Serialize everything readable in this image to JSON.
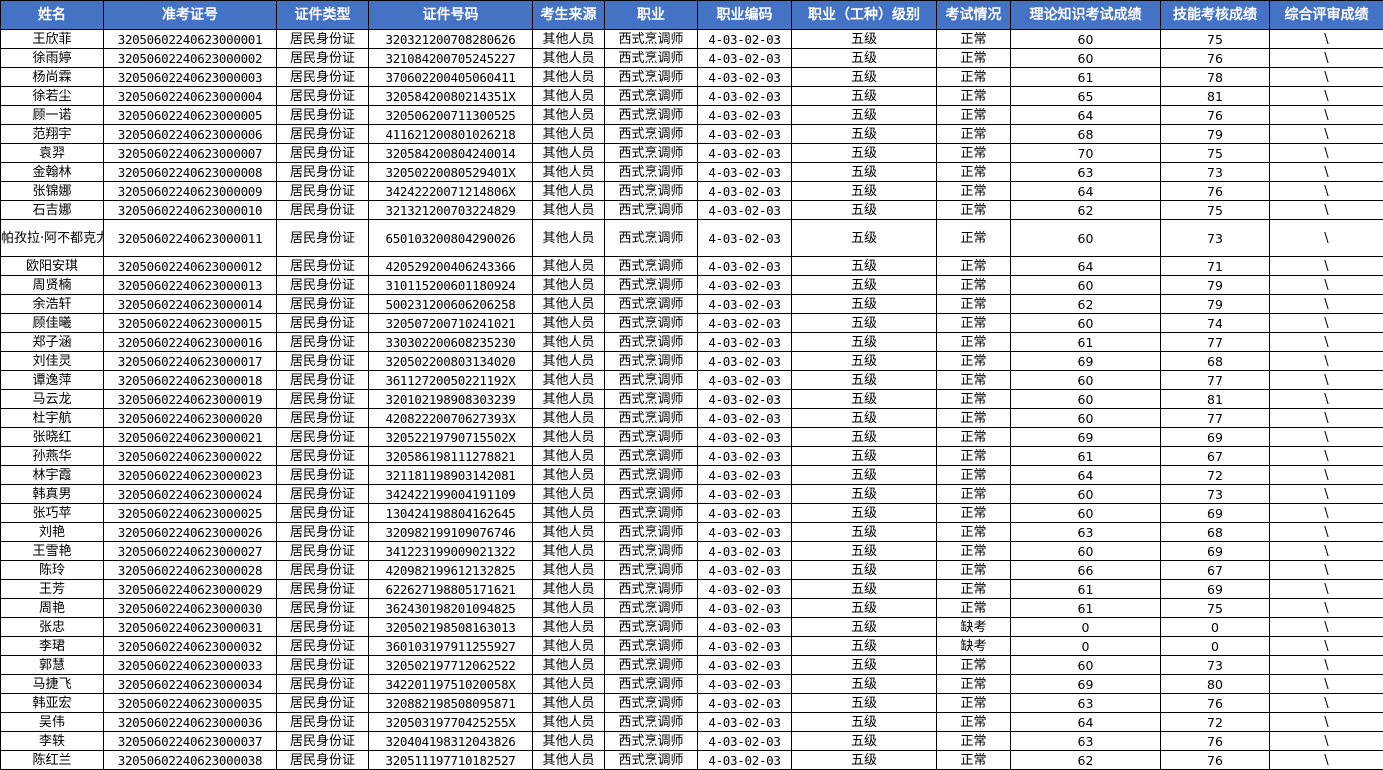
{
  "headers": [
    "姓名",
    "准考证号",
    "证件类型",
    "证件号码",
    "考生来源",
    "职业",
    "职业编码",
    "职业（工种）级别",
    "考试情况",
    "理论知识考试成绩",
    "技能考核成绩",
    "综合评审成绩"
  ],
  "rows": [
    [
      "王欣菲",
      "32050602240623000001",
      "居民身份证",
      "320321200708280626",
      "其他人员",
      "西式烹调师",
      "4-03-02-03",
      "五级",
      "正常",
      "60",
      "75",
      "\\"
    ],
    [
      "徐雨婷",
      "32050602240623000002",
      "居民身份证",
      "321084200705245227",
      "其他人员",
      "西式烹调师",
      "4-03-02-03",
      "五级",
      "正常",
      "60",
      "76",
      "\\"
    ],
    [
      "杨尚霖",
      "32050602240623000003",
      "居民身份证",
      "370602200405060411",
      "其他人员",
      "西式烹调师",
      "4-03-02-03",
      "五级",
      "正常",
      "61",
      "78",
      "\\"
    ],
    [
      "徐若尘",
      "32050602240623000004",
      "居民身份证",
      "32058420080214351X",
      "其他人员",
      "西式烹调师",
      "4-03-02-03",
      "五级",
      "正常",
      "65",
      "81",
      "\\"
    ],
    [
      "顾一诺",
      "32050602240623000005",
      "居民身份证",
      "320506200711300525",
      "其他人员",
      "西式烹调师",
      "4-03-02-03",
      "五级",
      "正常",
      "64",
      "76",
      "\\"
    ],
    [
      "范翔宇",
      "32050602240623000006",
      "居民身份证",
      "411621200801026218",
      "其他人员",
      "西式烹调师",
      "4-03-02-03",
      "五级",
      "正常",
      "68",
      "79",
      "\\"
    ],
    [
      "袁羿",
      "32050602240623000007",
      "居民身份证",
      "320584200804240014",
      "其他人员",
      "西式烹调师",
      "4-03-02-03",
      "五级",
      "正常",
      "70",
      "75",
      "\\"
    ],
    [
      "金翰林",
      "32050602240623000008",
      "居民身份证",
      "32050220080529401X",
      "其他人员",
      "西式烹调师",
      "4-03-02-03",
      "五级",
      "正常",
      "63",
      "73",
      "\\"
    ],
    [
      "张锦娜",
      "32050602240623000009",
      "居民身份证",
      "34242220071214806X",
      "其他人员",
      "西式烹调师",
      "4-03-02-03",
      "五级",
      "正常",
      "64",
      "76",
      "\\"
    ],
    [
      "石吉娜",
      "32050602240623000010",
      "居民身份证",
      "321321200703224829",
      "其他人员",
      "西式烹调师",
      "4-03-02-03",
      "五级",
      "正常",
      "62",
      "75",
      "\\"
    ],
    [
      "帕孜拉·阿不都克尤木",
      "32050602240623000011",
      "居民身份证",
      "650103200804290026",
      "其他人员",
      "西式烹调师",
      "4-03-02-03",
      "五级",
      "正常",
      "60",
      "73",
      "\\"
    ],
    [
      "欧阳安琪",
      "32050602240623000012",
      "居民身份证",
      "420529200406243366",
      "其他人员",
      "西式烹调师",
      "4-03-02-03",
      "五级",
      "正常",
      "64",
      "71",
      "\\"
    ],
    [
      "周贤楠",
      "32050602240623000013",
      "居民身份证",
      "310115200601180924",
      "其他人员",
      "西式烹调师",
      "4-03-02-03",
      "五级",
      "正常",
      "60",
      "79",
      "\\"
    ],
    [
      "余浩轩",
      "32050602240623000014",
      "居民身份证",
      "500231200606206258",
      "其他人员",
      "西式烹调师",
      "4-03-02-03",
      "五级",
      "正常",
      "62",
      "79",
      "\\"
    ],
    [
      "顾佳曦",
      "32050602240623000015",
      "居民身份证",
      "320507200710241021",
      "其他人员",
      "西式烹调师",
      "4-03-02-03",
      "五级",
      "正常",
      "60",
      "74",
      "\\"
    ],
    [
      "郑子涵",
      "32050602240623000016",
      "居民身份证",
      "330302200608235230",
      "其他人员",
      "西式烹调师",
      "4-03-02-03",
      "五级",
      "正常",
      "61",
      "77",
      "\\"
    ],
    [
      "刘佳灵",
      "32050602240623000017",
      "居民身份证",
      "320502200803134020",
      "其他人员",
      "西式烹调师",
      "4-03-02-03",
      "五级",
      "正常",
      "69",
      "68",
      "\\"
    ],
    [
      "谭逸萍",
      "32050602240623000018",
      "居民身份证",
      "36112720050221192X",
      "其他人员",
      "西式烹调师",
      "4-03-02-03",
      "五级",
      "正常",
      "60",
      "77",
      "\\"
    ],
    [
      "马云龙",
      "32050602240623000019",
      "居民身份证",
      "320102198908303239",
      "其他人员",
      "西式烹调师",
      "4-03-02-03",
      "五级",
      "正常",
      "60",
      "81",
      "\\"
    ],
    [
      "杜宇航",
      "32050602240623000020",
      "居民身份证",
      "42082220070627393X",
      "其他人员",
      "西式烹调师",
      "4-03-02-03",
      "五级",
      "正常",
      "60",
      "77",
      "\\"
    ],
    [
      "张晓红",
      "32050602240623000021",
      "居民身份证",
      "32052219790715502X",
      "其他人员",
      "西式烹调师",
      "4-03-02-03",
      "五级",
      "正常",
      "69",
      "69",
      "\\"
    ],
    [
      "孙燕华",
      "32050602240623000022",
      "居民身份证",
      "320586198111278821",
      "其他人员",
      "西式烹调师",
      "4-03-02-03",
      "五级",
      "正常",
      "61",
      "67",
      "\\"
    ],
    [
      "林宇霞",
      "32050602240623000023",
      "居民身份证",
      "321181198903142081",
      "其他人员",
      "西式烹调师",
      "4-03-02-03",
      "五级",
      "正常",
      "64",
      "72",
      "\\"
    ],
    [
      "韩真男",
      "32050602240623000024",
      "居民身份证",
      "342422199004191109",
      "其他人员",
      "西式烹调师",
      "4-03-02-03",
      "五级",
      "正常",
      "60",
      "73",
      "\\"
    ],
    [
      "张巧苹",
      "32050602240623000025",
      "居民身份证",
      "130424198804162645",
      "其他人员",
      "西式烹调师",
      "4-03-02-03",
      "五级",
      "正常",
      "60",
      "69",
      "\\"
    ],
    [
      "刘艳",
      "32050602240623000026",
      "居民身份证",
      "320982199109076746",
      "其他人员",
      "西式烹调师",
      "4-03-02-03",
      "五级",
      "正常",
      "63",
      "68",
      "\\"
    ],
    [
      "王雪艳",
      "32050602240623000027",
      "居民身份证",
      "341223199009021322",
      "其他人员",
      "西式烹调师",
      "4-03-02-03",
      "五级",
      "正常",
      "60",
      "69",
      "\\"
    ],
    [
      "陈玲",
      "32050602240623000028",
      "居民身份证",
      "420982199612132825",
      "其他人员",
      "西式烹调师",
      "4-03-02-03",
      "五级",
      "正常",
      "66",
      "67",
      "\\"
    ],
    [
      "王芳",
      "32050602240623000029",
      "居民身份证",
      "622627198805171621",
      "其他人员",
      "西式烹调师",
      "4-03-02-03",
      "五级",
      "正常",
      "61",
      "69",
      "\\"
    ],
    [
      "周艳",
      "32050602240623000030",
      "居民身份证",
      "362430198201094825",
      "其他人员",
      "西式烹调师",
      "4-03-02-03",
      "五级",
      "正常",
      "61",
      "75",
      "\\"
    ],
    [
      "张忠",
      "32050602240623000031",
      "居民身份证",
      "320502198508163013",
      "其他人员",
      "西式烹调师",
      "4-03-02-03",
      "五级",
      "缺考",
      "0",
      "0",
      "\\"
    ],
    [
      "李珺",
      "32050602240623000032",
      "居民身份证",
      "360103197911255927",
      "其他人员",
      "西式烹调师",
      "4-03-02-03",
      "五级",
      "缺考",
      "0",
      "0",
      "\\"
    ],
    [
      "郭慧",
      "32050602240623000033",
      "居民身份证",
      "320502197712062522",
      "其他人员",
      "西式烹调师",
      "4-03-02-03",
      "五级",
      "正常",
      "60",
      "73",
      "\\"
    ],
    [
      "马捷飞",
      "32050602240623000034",
      "居民身份证",
      "34220119751020058X",
      "其他人员",
      "西式烹调师",
      "4-03-02-03",
      "五级",
      "正常",
      "69",
      "80",
      "\\"
    ],
    [
      "韩亚宏",
      "32050602240623000035",
      "居民身份证",
      "320882198508095871",
      "其他人员",
      "西式烹调师",
      "4-03-02-03",
      "五级",
      "正常",
      "63",
      "76",
      "\\"
    ],
    [
      "吴伟",
      "32050602240623000036",
      "居民身份证",
      "32050319770425255X",
      "其他人员",
      "西式烹调师",
      "4-03-02-03",
      "五级",
      "正常",
      "64",
      "72",
      "\\"
    ],
    [
      "李轶",
      "32050602240623000037",
      "居民身份证",
      "320404198312043826",
      "其他人员",
      "西式烹调师",
      "4-03-02-03",
      "五级",
      "正常",
      "63",
      "76",
      "\\"
    ],
    [
      "陈红兰",
      "32050602240623000038",
      "居民身份证",
      "320511197710182527",
      "其他人员",
      "西式烹调师",
      "4-03-02-03",
      "五级",
      "正常",
      "62",
      "76",
      "\\"
    ]
  ],
  "colors": {
    "header_bg": "#4472c4",
    "header_text": "#ffffff",
    "border": "#000000"
  }
}
